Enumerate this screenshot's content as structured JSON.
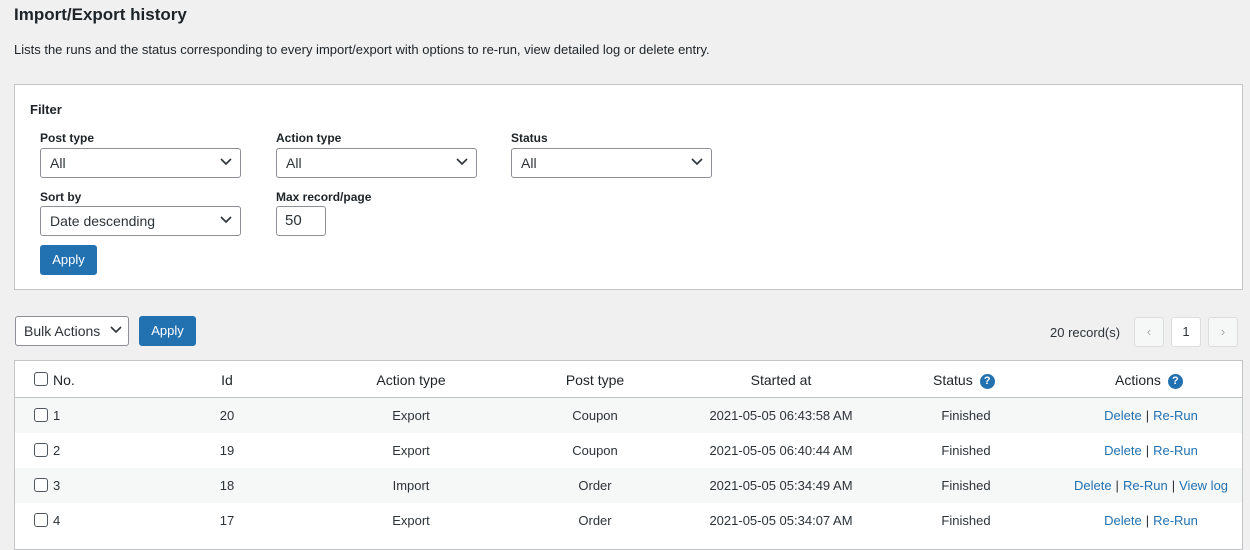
{
  "page": {
    "title": "Import/Export history",
    "description": "Lists the runs and the status corresponding to every import/export with options to re-run, view detailed log or delete entry."
  },
  "filter": {
    "title": "Filter",
    "post_type": {
      "label": "Post type",
      "value": "All"
    },
    "action_type": {
      "label": "Action type",
      "value": "All"
    },
    "status": {
      "label": "Status",
      "value": "All"
    },
    "sort_by": {
      "label": "Sort by",
      "value": "Date descending"
    },
    "max_record": {
      "label": "Max record/page",
      "value": "50"
    },
    "apply_label": "Apply"
  },
  "toolbar": {
    "bulk_actions": "Bulk Actions",
    "apply_label": "Apply",
    "records": "20 record(s)",
    "prev": "‹",
    "current_page": "1",
    "next": "›"
  },
  "table": {
    "headers": {
      "no": "No.",
      "id": "Id",
      "action_type": "Action type",
      "post_type": "Post type",
      "started_at": "Started at",
      "status": "Status",
      "actions": "Actions"
    },
    "help_glyph": "?",
    "action_labels": {
      "delete": "Delete",
      "rerun": "Re-Run",
      "view_log": "View log",
      "sep": "|"
    },
    "rows": [
      {
        "no": "1",
        "id": "20",
        "action_type": "Export",
        "post_type": "Coupon",
        "started_at": "2021-05-05 06:43:58 AM",
        "status": "Finished"
      },
      {
        "no": "2",
        "id": "19",
        "action_type": "Export",
        "post_type": "Coupon",
        "started_at": "2021-05-05 06:40:44 AM",
        "status": "Finished"
      },
      {
        "no": "3",
        "id": "18",
        "action_type": "Import",
        "post_type": "Order",
        "started_at": "2021-05-05 05:34:49 AM",
        "status": "Finished"
      },
      {
        "no": "4",
        "id": "17",
        "action_type": "Export",
        "post_type": "Order",
        "started_at": "2021-05-05 05:34:07 AM",
        "status": "Finished"
      }
    ]
  },
  "colors": {
    "accent": "#2271b1",
    "background": "#f0f0f1",
    "border": "#c3c4c7"
  }
}
